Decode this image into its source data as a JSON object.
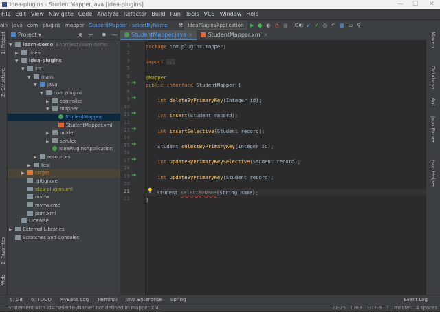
{
  "window": {
    "title": "idea-plugins - StudentMapper.java [idea-plugins]"
  },
  "menu": [
    "File",
    "Edit",
    "View",
    "Navigate",
    "Code",
    "Analyze",
    "Refactor",
    "Build",
    "Run",
    "Tools",
    "VCS",
    "Window",
    "Help"
  ],
  "breadcrumb": [
    "ain",
    "java",
    "com",
    "plugins",
    "mapper",
    "StudentMapper",
    "selectByName"
  ],
  "run_config": "IdeaPluginsApplication",
  "git_label": "Git:",
  "left_strip": [
    "1: Project",
    "Z: Structure",
    "2: Favorites",
    "Web"
  ],
  "right_strip": [
    "Maven",
    "Database",
    "Ant",
    "Json Parser",
    "Json Helper"
  ],
  "project_panel": {
    "title": "Project"
  },
  "tree": [
    {
      "label": "learn-demo",
      "extra": "E:\\project\\learn-demo",
      "depth": 0,
      "arrow": "▼",
      "bold": true
    },
    {
      "label": ".idea",
      "depth": 1,
      "arrow": "▶"
    },
    {
      "label": "idea-plugins",
      "depth": 1,
      "arrow": "▼",
      "bold": true
    },
    {
      "label": "src",
      "depth": 2,
      "arrow": "▼"
    },
    {
      "label": "main",
      "depth": 3,
      "arrow": "▼"
    },
    {
      "label": "java",
      "depth": 4,
      "arrow": "▼"
    },
    {
      "label": "com.plugins",
      "depth": 5,
      "arrow": "▼"
    },
    {
      "label": "controller",
      "depth": 6,
      "arrow": "▶"
    },
    {
      "label": "mapper",
      "depth": 6,
      "arrow": "▼"
    },
    {
      "label": "StudentMapper",
      "depth": 7,
      "arrow": "",
      "selected": true
    },
    {
      "label": "StudentMapper.xml",
      "depth": 7,
      "arrow": ""
    },
    {
      "label": "model",
      "depth": 6,
      "arrow": "▶"
    },
    {
      "label": "service",
      "depth": 6,
      "arrow": "▶"
    },
    {
      "label": "IdeaPluginsApplication",
      "depth": 6,
      "arrow": ""
    },
    {
      "label": "resources",
      "depth": 4,
      "arrow": "▶"
    },
    {
      "label": "test",
      "depth": 3,
      "arrow": "▶"
    },
    {
      "label": "target",
      "depth": 2,
      "arrow": "▶",
      "target": true
    },
    {
      "label": ".gitignore",
      "depth": 2,
      "arrow": ""
    },
    {
      "label": "idea-plugins.iml",
      "depth": 2,
      "arrow": "",
      "iml": true
    },
    {
      "label": "mvnw",
      "depth": 2,
      "arrow": ""
    },
    {
      "label": "mvnw.cmd",
      "depth": 2,
      "arrow": ""
    },
    {
      "label": "pom.xml",
      "depth": 2,
      "arrow": ""
    },
    {
      "label": "LICENSE",
      "depth": 1,
      "arrow": ""
    },
    {
      "label": "External Libraries",
      "depth": 0,
      "arrow": "▶"
    },
    {
      "label": "Scratches and Consoles",
      "depth": 0,
      "arrow": ""
    }
  ],
  "tabs": [
    {
      "label": "StudentMapper.java",
      "active": true
    },
    {
      "label": "StudentMapper.xml",
      "active": false
    }
  ],
  "code": [
    {
      "n": "1",
      "html": "<span class='kw'>package</span> com.plugins.mapper;"
    },
    {
      "n": "2",
      "html": ""
    },
    {
      "n": "3",
      "html": "<span class='kw'>import</span> <span style='color:#808080;background:#3a3a3a'>...</span>"
    },
    {
      "n": "5",
      "html": ""
    },
    {
      "n": "6",
      "html": "<span class='an'>@Mapper</span>"
    },
    {
      "n": "7",
      "html": "<span class='kw'>public interface</span> StudentMapper {",
      "gi": true
    },
    {
      "n": "8",
      "html": ""
    },
    {
      "n": "9",
      "html": "    <span class='kw'>int</span> <span class='fn'>deleteByPrimaryKey</span>(Integer id);",
      "gi": true
    },
    {
      "n": "10",
      "html": ""
    },
    {
      "n": "11",
      "html": "    <span class='kw'>int</span> <span class='fn'>insert</span>(Student record);",
      "gi": true
    },
    {
      "n": "12",
      "html": ""
    },
    {
      "n": "13",
      "html": "    <span class='kw'>int</span> <span class='fn'>insertSelective</span>(Student record);",
      "gi": true
    },
    {
      "n": "14",
      "html": ""
    },
    {
      "n": "15",
      "html": "    Student <span class='fn'>selectByPrimaryKey</span>(Integer id);",
      "gi": true
    },
    {
      "n": "16",
      "html": ""
    },
    {
      "n": "17",
      "html": "    <span class='kw'>int</span> <span class='fn'>updateByPrimaryKeySelective</span>(Student record);",
      "gi": true
    },
    {
      "n": "18",
      "html": ""
    },
    {
      "n": "19",
      "html": "    <span class='kw'>int</span> <span class='fn'>updateByPrimaryKey</span>(Student record);",
      "gi": true
    },
    {
      "n": "20",
      "html": ""
    },
    {
      "n": "21",
      "html": "    Student <span class='err'>selectByName</span>(String name);",
      "cur": true
    },
    {
      "n": "22",
      "html": "}"
    }
  ],
  "toolbar_bottom": [
    "9: Git",
    "6: TODO",
    "MyBatis Log",
    "Terminal",
    "Java Enterprise",
    "Spring"
  ],
  "event_log": "Event Log",
  "status": {
    "message": "Statement with id=\"selectByName\" not defined in mapper XML",
    "position": "21:25",
    "line_sep": "CRLF",
    "encoding": "UTF-8",
    "branch": "master",
    "indent": "4 spaces"
  }
}
